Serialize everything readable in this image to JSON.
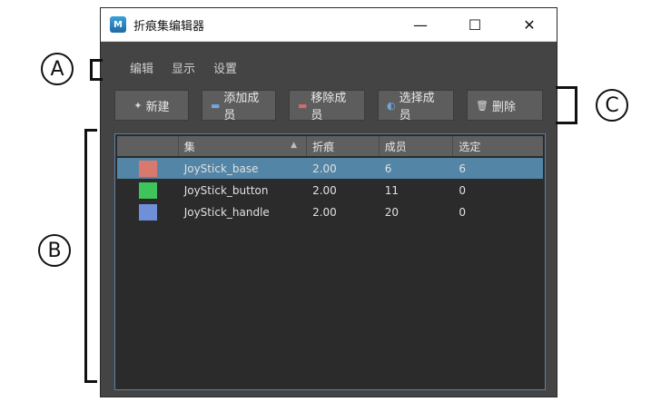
{
  "window": {
    "title": "折痕集编辑器",
    "app_icon_letter": "M"
  },
  "window_controls": {
    "minimize": "—",
    "maximize": "☐",
    "close": "✕"
  },
  "menu": [
    "编辑",
    "显示",
    "设置"
  ],
  "toolbar": [
    {
      "icon": "✦",
      "label": "新建"
    },
    {
      "icon": "▬",
      "label": "添加成员"
    },
    {
      "icon": "▬",
      "label": "移除成员"
    },
    {
      "icon": "◐",
      "label": "选择成员"
    },
    {
      "icon": "🗑",
      "label": "删除"
    }
  ],
  "table": {
    "columns": [
      "",
      "集",
      "折痕",
      "成员",
      "选定"
    ],
    "sort_indicator": "▲",
    "rows": [
      {
        "color": "#d9786c",
        "name": "JoyStick_base",
        "crease": "2.00",
        "members": "6",
        "selected": "6",
        "highlighted": true
      },
      {
        "color": "#3ec45a",
        "name": "JoyStick_button",
        "crease": "2.00",
        "members": "11",
        "selected": "0",
        "highlighted": false
      },
      {
        "color": "#6f8fd8",
        "name": "JoyStick_handle",
        "crease": "2.00",
        "members": "20",
        "selected": "0",
        "highlighted": false
      }
    ]
  },
  "annotations": {
    "a": "A",
    "b": "B",
    "c": "C"
  }
}
